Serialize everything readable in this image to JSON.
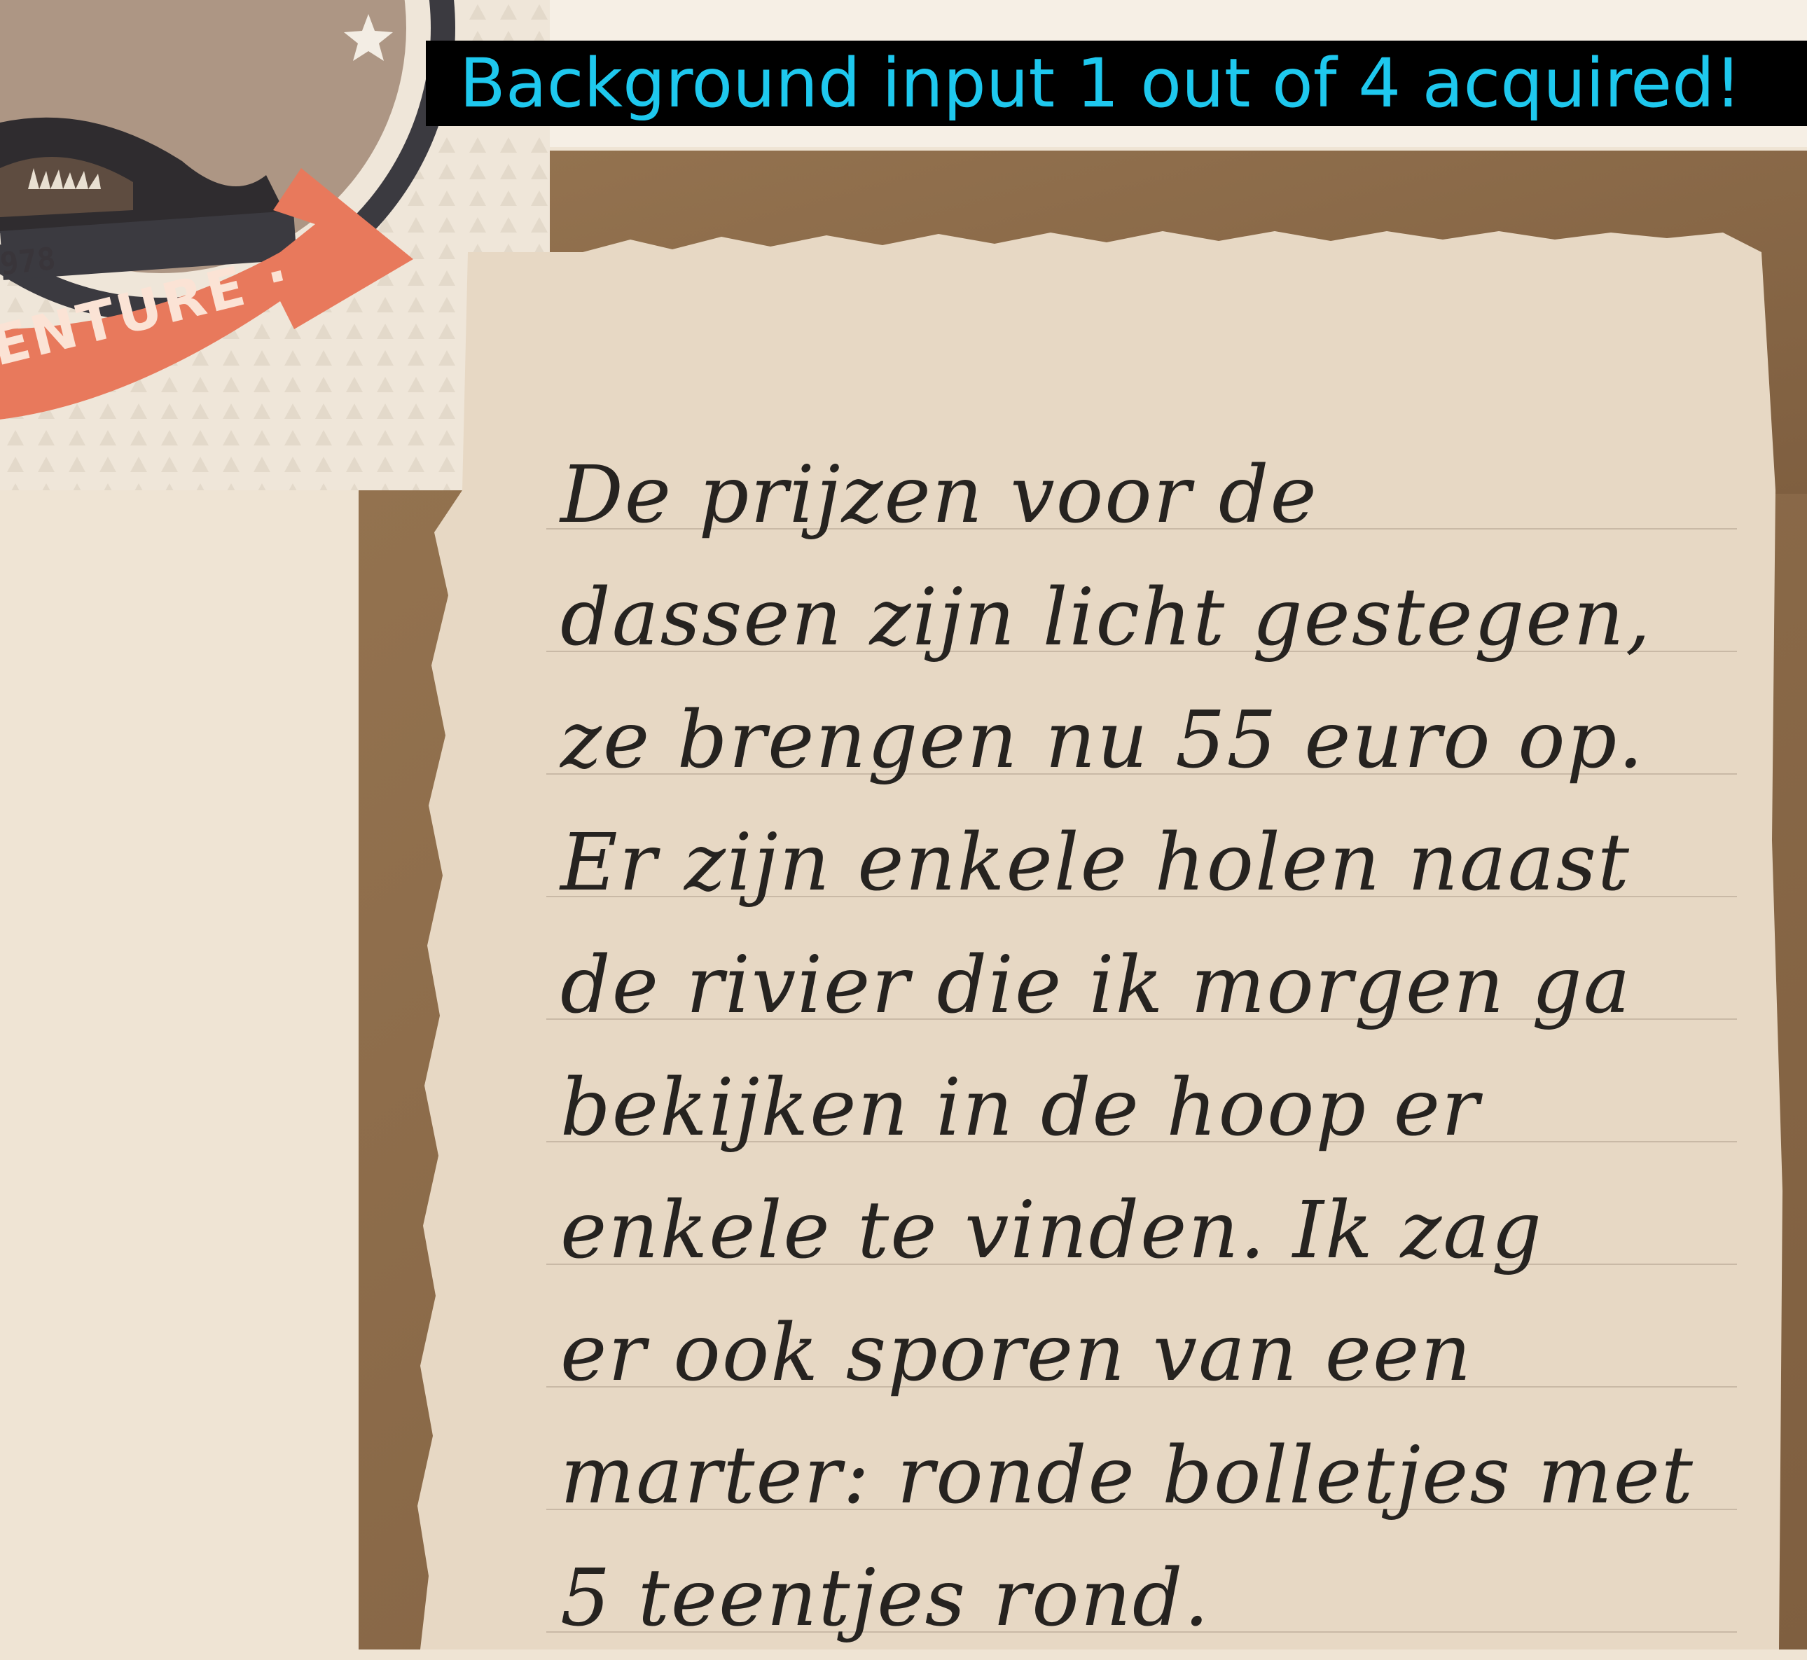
{
  "banner": {
    "text": "Background input 1 out of 4 acquired!",
    "text_color": "#1ec8ee",
    "background_color": "#000000"
  },
  "badge": {
    "year_fragment": "978",
    "ribbon_text": "ENTURE ·",
    "ribbon_color": "#e8795c"
  },
  "note": {
    "lines": [
      "De prijzen voor de",
      "dassen zijn licht gestegen,",
      "ze brengen nu 55 euro op.",
      "Er zijn enkele holen naast",
      "de rivier die ik morgen ga",
      "bekijken in de hoop er",
      "enkele te vinden. Ik zag",
      "er ook sporen van een",
      "marter: ronde bolletjes met",
      "5 teentjes rond."
    ],
    "paper_color": "#e7d8c4",
    "board_color": "#8a6a4a"
  }
}
